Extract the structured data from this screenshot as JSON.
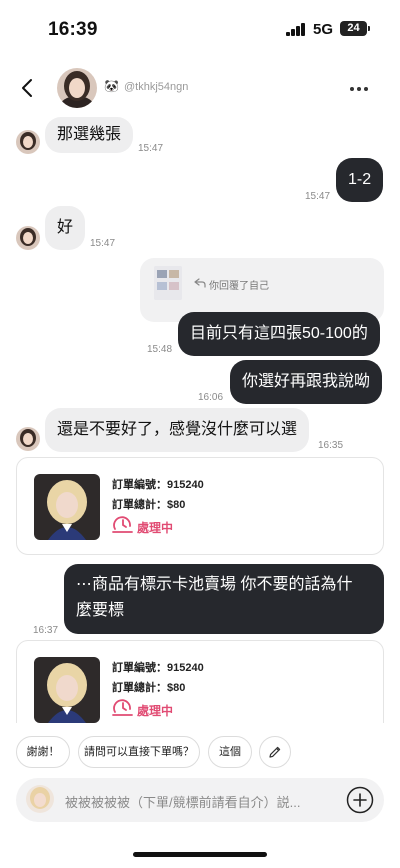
{
  "status_bar": {
    "time": "16:39",
    "network": "5G",
    "battery": "24"
  },
  "header": {
    "username": "@tkhkj54ngn",
    "badge_icon": "panda-icon"
  },
  "messages": [
    {
      "dir": "in",
      "text": "那選幾張",
      "time": "15:47"
    },
    {
      "dir": "out",
      "text": "1-2",
      "time": "15:47"
    },
    {
      "dir": "in",
      "text": "好",
      "time": "15:47"
    },
    {
      "dir": "out",
      "reply_label": "你回覆了自己",
      "text": "目前只有這四張50-100的",
      "time": "15:48"
    },
    {
      "dir": "out",
      "text": "你選好再跟我說呦",
      "time": "16:06"
    },
    {
      "dir": "in",
      "text": "還是不要好了，感覺沒什麼可以選",
      "time": "16:35"
    },
    {
      "dir": "out",
      "text_line1": "⋯商品有標示卡池賣場 你不要的話為什",
      "text_line2": "麼要標",
      "time": "16:37"
    }
  ],
  "orders": [
    {
      "number": "訂單編號：915240",
      "total": "訂單總計：$80",
      "status": "處理中"
    },
    {
      "number": "訂單編號：915240",
      "total": "訂單總計：$80",
      "status": "處理中"
    }
  ],
  "quick_replies": [
    "謝謝！",
    "請問可以直接下單嗎？",
    "這個"
  ],
  "input": {
    "placeholder": "被被被被被（下單/競標前請看自介）説..."
  },
  "colors": {
    "outgoing_bubble": "#26282d",
    "incoming_bubble": "#eeeeef",
    "status_accent": "#e14b73"
  }
}
